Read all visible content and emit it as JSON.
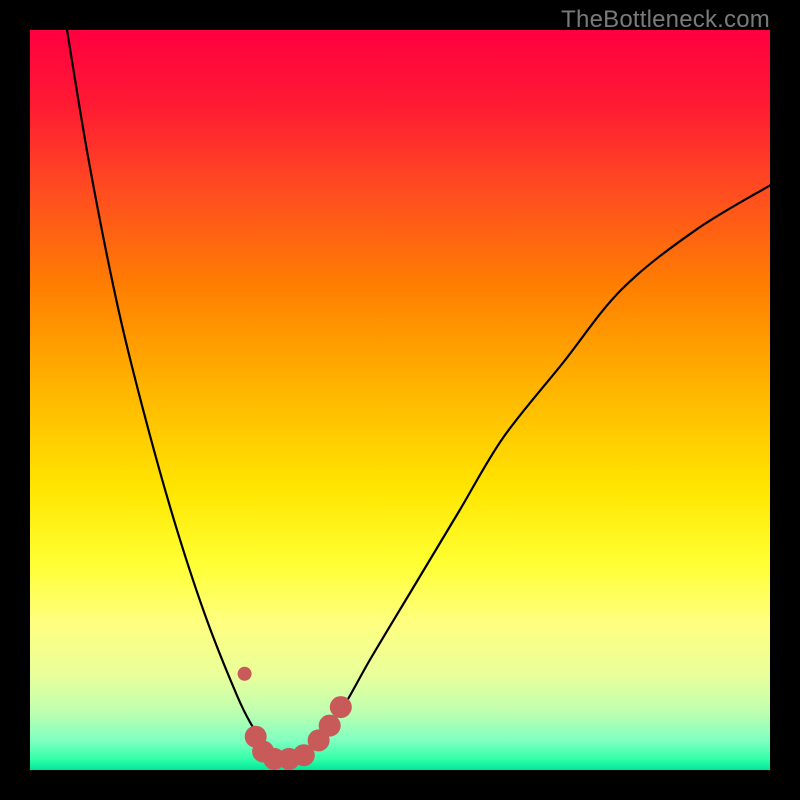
{
  "watermark": "TheBottleneck.com",
  "chart_data": {
    "type": "line",
    "title": "",
    "xlabel": "",
    "ylabel": "",
    "xlim": [
      0,
      100
    ],
    "ylim": [
      0,
      100
    ],
    "grid": false,
    "legend": false,
    "series": [
      {
        "name": "bottleneck-curve",
        "x": [
          5,
          8,
          12,
          16,
          20,
          24,
          28,
          30,
          32,
          34,
          36,
          38,
          42,
          46,
          52,
          58,
          64,
          72,
          80,
          90,
          100
        ],
        "y": [
          100,
          82,
          62,
          46,
          32,
          20,
          10,
          6,
          3,
          1.5,
          1.5,
          3,
          8,
          15,
          25,
          35,
          45,
          55,
          65,
          73,
          79
        ]
      }
    ],
    "markers": [
      {
        "name": "left-dip-dot",
        "x": 29,
        "y": 13
      },
      {
        "name": "bottom-dot-1",
        "x": 30.5,
        "y": 4.5
      },
      {
        "name": "bottom-dot-2",
        "x": 31.5,
        "y": 2.5
      },
      {
        "name": "bottom-dot-3",
        "x": 33,
        "y": 1.5
      },
      {
        "name": "bottom-dot-4",
        "x": 35,
        "y": 1.5
      },
      {
        "name": "bottom-dot-5",
        "x": 37,
        "y": 2
      },
      {
        "name": "bottom-dot-6",
        "x": 39,
        "y": 4
      },
      {
        "name": "bottom-dot-7",
        "x": 40.5,
        "y": 6
      },
      {
        "name": "bottom-dot-8",
        "x": 42,
        "y": 8.5
      }
    ],
    "marker_color": "#c85a5a",
    "curve_color": "#000000"
  }
}
